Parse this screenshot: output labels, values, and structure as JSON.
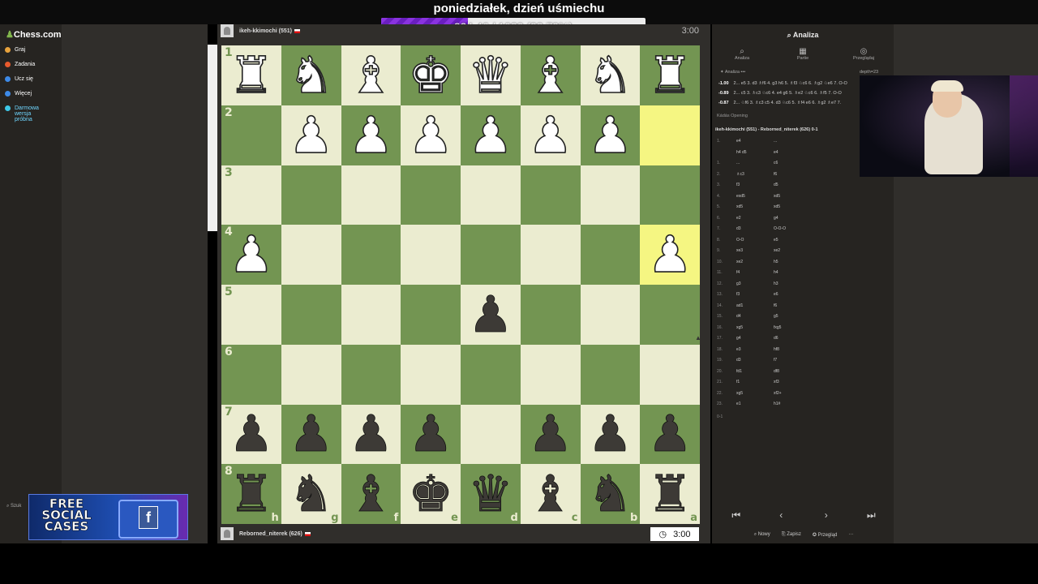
{
  "stream": {
    "title": "poniedziałek, dzień uśmiechu",
    "goal_text": "334.46 / 1020 (32.79%)",
    "goal_fraction": 0.3279
  },
  "sidebar": {
    "logo": "Chess.com",
    "items": [
      {
        "label": "Graj",
        "color": "#e8a33d"
      },
      {
        "label": "Zadania",
        "color": "#e85a2d"
      },
      {
        "label": "Ucz się",
        "color": "#3d8ae8"
      },
      {
        "label": "Więcej",
        "color": "#3d8ae8"
      },
      {
        "label": "Darmowa wersja próbna",
        "color": "#3dc8e8"
      }
    ],
    "bottom_label": "Szuk"
  },
  "players": {
    "top": {
      "name": "ikeh-kkimochi (551)",
      "clock": "3:00"
    },
    "bottom": {
      "name": "Reborned_niterek (626)",
      "clock": "3:00"
    }
  },
  "board": {
    "ranks": [
      "1",
      "2",
      "3",
      "4",
      "5",
      "6",
      "7",
      "8"
    ],
    "files": [
      "h",
      "g",
      "f",
      "e",
      "d",
      "c",
      "b",
      "a"
    ],
    "highlight": [
      [
        1,
        7
      ],
      [
        3,
        7
      ]
    ],
    "pieces": [
      {
        "r": 0,
        "c": 0,
        "p": "♜",
        "side": "w"
      },
      {
        "r": 0,
        "c": 1,
        "p": "♞",
        "side": "w"
      },
      {
        "r": 0,
        "c": 2,
        "p": "♝",
        "side": "w"
      },
      {
        "r": 0,
        "c": 3,
        "p": "♚",
        "side": "w"
      },
      {
        "r": 0,
        "c": 4,
        "p": "♛",
        "side": "w"
      },
      {
        "r": 0,
        "c": 5,
        "p": "♝",
        "side": "w"
      },
      {
        "r": 0,
        "c": 6,
        "p": "♞",
        "side": "w"
      },
      {
        "r": 0,
        "c": 7,
        "p": "♜",
        "side": "w"
      },
      {
        "r": 1,
        "c": 1,
        "p": "♟",
        "side": "w"
      },
      {
        "r": 1,
        "c": 2,
        "p": "♟",
        "side": "w"
      },
      {
        "r": 1,
        "c": 3,
        "p": "♟",
        "side": "w"
      },
      {
        "r": 1,
        "c": 4,
        "p": "♟",
        "side": "w"
      },
      {
        "r": 1,
        "c": 5,
        "p": "♟",
        "side": "w"
      },
      {
        "r": 1,
        "c": 6,
        "p": "♟",
        "side": "w"
      },
      {
        "r": 3,
        "c": 0,
        "p": "♟",
        "side": "w"
      },
      {
        "r": 3,
        "c": 7,
        "p": "♟",
        "side": "w"
      },
      {
        "r": 4,
        "c": 4,
        "p": "♟",
        "side": "b"
      },
      {
        "r": 6,
        "c": 0,
        "p": "♟",
        "side": "b"
      },
      {
        "r": 6,
        "c": 1,
        "p": "♟",
        "side": "b"
      },
      {
        "r": 6,
        "c": 2,
        "p": "♟",
        "side": "b"
      },
      {
        "r": 6,
        "c": 3,
        "p": "♟",
        "side": "b"
      },
      {
        "r": 6,
        "c": 5,
        "p": "♟",
        "side": "b"
      },
      {
        "r": 6,
        "c": 6,
        "p": "♟",
        "side": "b"
      },
      {
        "r": 6,
        "c": 7,
        "p": "♟",
        "side": "b"
      },
      {
        "r": 7,
        "c": 0,
        "p": "♜",
        "side": "b"
      },
      {
        "r": 7,
        "c": 1,
        "p": "♞",
        "side": "b"
      },
      {
        "r": 7,
        "c": 2,
        "p": "♝",
        "side": "b"
      },
      {
        "r": 7,
        "c": 3,
        "p": "♚",
        "side": "b"
      },
      {
        "r": 7,
        "c": 4,
        "p": "♛",
        "side": "b"
      },
      {
        "r": 7,
        "c": 5,
        "p": "♝",
        "side": "b"
      },
      {
        "r": 7,
        "c": 6,
        "p": "♞",
        "side": "b"
      },
      {
        "r": 7,
        "c": 7,
        "p": "♜",
        "side": "b"
      }
    ]
  },
  "panel": {
    "title": "Analiza",
    "tabs": [
      "Analiza",
      "Partie",
      "Przeglądaj"
    ],
    "engine_label": "Analiza",
    "depth": "depth=23",
    "lines": [
      {
        "eval": "-1.00",
        "text": "2... e5 3. d3 ♗f6 4. g3 h6 5. ♗f3 ♘c6 6. ♗g2 ♘e6 7. O-O"
      },
      {
        "eval": "-0.89",
        "text": "2... c5 3. ♗c3 ♘c6 4. e4 g6 5. ♗e2 ♘c6 6. ♗f5 7. O-O"
      },
      {
        "eval": "-0.87",
        "text": "2... ♘f6 3. ♗c3 c5 4. d3 ♘c6 5. ♗f4 e6 6. ♗g2 ♗e7 7."
      }
    ],
    "opening": "Kádás Opening",
    "game": "ikeh-kkimochi (551) - Reborned_niterek (626) 0-1",
    "moves": [
      {
        "n": "1.",
        "w": "e4",
        "b": "..."
      },
      {
        "n": "",
        "w": "h4 d5",
        "b": "e4"
      },
      {
        "n": "1.",
        "w": "...",
        "b": "c6"
      },
      {
        "n": "2.",
        "w": "♗c3",
        "b": "f6"
      },
      {
        "n": "3.",
        "w": "f3",
        "b": "d5"
      },
      {
        "n": "4.",
        "w": "exd5",
        "b": "xd5"
      },
      {
        "n": "5.",
        "w": "xd5",
        "b": "xd5"
      },
      {
        "n": "6.",
        "w": "e2",
        "b": "g4"
      },
      {
        "n": "7.",
        "w": "d3",
        "b": "O-O-O"
      },
      {
        "n": "8.",
        "w": "O-O",
        "b": "e5"
      },
      {
        "n": "9.",
        "w": "xe3",
        "b": "xe2"
      },
      {
        "n": "10.",
        "w": "xe2",
        "b": "h5"
      },
      {
        "n": "11.",
        "w": "f4",
        "b": "h4"
      },
      {
        "n": "12.",
        "w": "g3",
        "b": "h3"
      },
      {
        "n": "13.",
        "w": "f3",
        "b": "e6"
      },
      {
        "n": "14.",
        "w": "ad1",
        "b": "f6"
      },
      {
        "n": "15.",
        "w": "d4",
        "b": "g5"
      },
      {
        "n": "16.",
        "w": "xg5",
        "b": "fxg5"
      },
      {
        "n": "17.",
        "w": "g4",
        "b": "d6"
      },
      {
        "n": "18.",
        "w": "e3",
        "b": "hf8"
      },
      {
        "n": "19.",
        "w": "d3",
        "b": "f7"
      },
      {
        "n": "20.",
        "w": "fd1",
        "b": "df8"
      },
      {
        "n": "21.",
        "w": "f1",
        "b": "xf3"
      },
      {
        "n": "22.",
        "w": "xg5",
        "b": "xf2+"
      },
      {
        "n": "23.",
        "w": "e1",
        "b": "h1#"
      }
    ],
    "result": "0-1",
    "nav": [
      "⏮",
      "‹",
      "›",
      "⏭"
    ],
    "footer": [
      "Nowy",
      "Zapisz",
      "Przegląd",
      "···"
    ]
  },
  "ad": {
    "text": "FREE SOCIAL CASES"
  }
}
